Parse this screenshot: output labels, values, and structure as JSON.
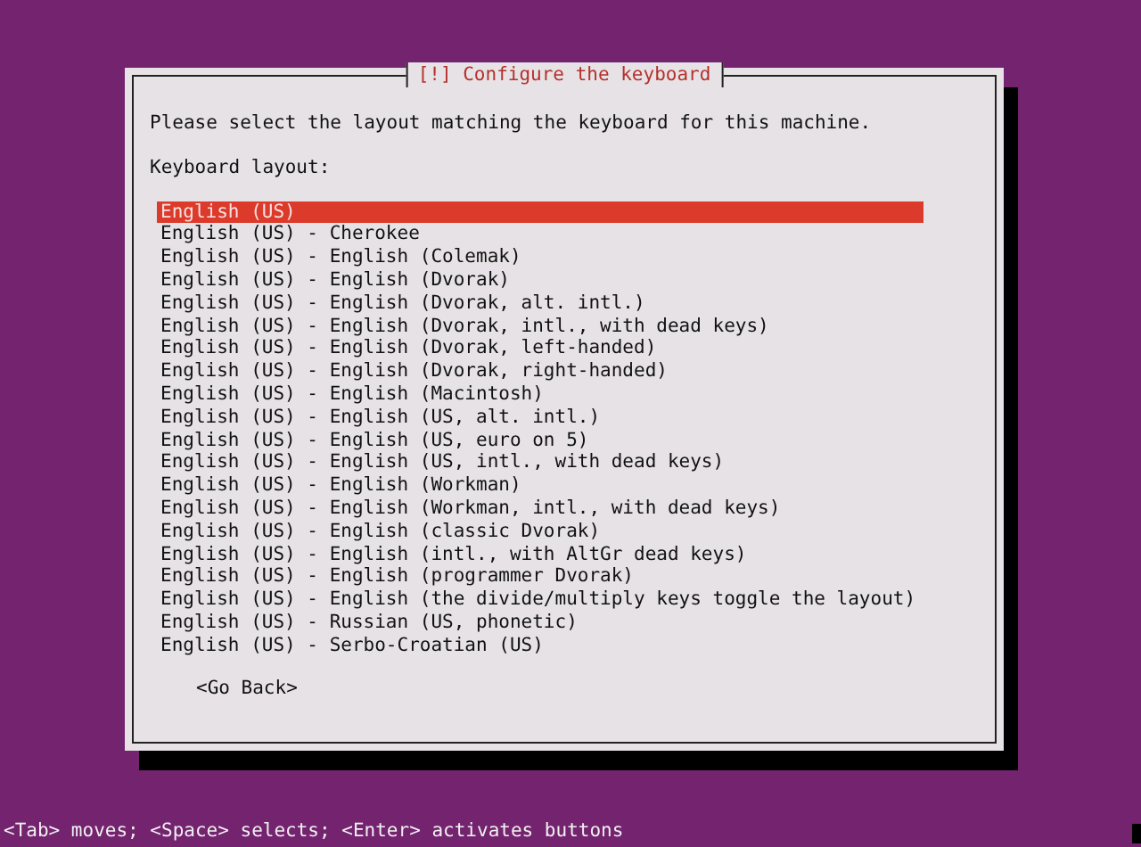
{
  "dialog": {
    "title": "[!] Configure the keyboard",
    "prompt": "Please select the layout matching the keyboard for this machine.",
    "list_label": "Keyboard layout:",
    "layouts": [
      {
        "label": "English (US)",
        "selected": true
      },
      {
        "label": "English (US) - Cherokee",
        "selected": false
      },
      {
        "label": "English (US) - English (Colemak)",
        "selected": false
      },
      {
        "label": "English (US) - English (Dvorak)",
        "selected": false
      },
      {
        "label": "English (US) - English (Dvorak, alt. intl.)",
        "selected": false
      },
      {
        "label": "English (US) - English (Dvorak, intl., with dead keys)",
        "selected": false
      },
      {
        "label": "English (US) - English (Dvorak, left-handed)",
        "selected": false
      },
      {
        "label": "English (US) - English (Dvorak, right-handed)",
        "selected": false
      },
      {
        "label": "English (US) - English (Macintosh)",
        "selected": false
      },
      {
        "label": "English (US) - English (US, alt. intl.)",
        "selected": false
      },
      {
        "label": "English (US) - English (US, euro on 5)",
        "selected": false
      },
      {
        "label": "English (US) - English (US, intl., with dead keys)",
        "selected": false
      },
      {
        "label": "English (US) - English (Workman)",
        "selected": false
      },
      {
        "label": "English (US) - English (Workman, intl., with dead keys)",
        "selected": false
      },
      {
        "label": "English (US) - English (classic Dvorak)",
        "selected": false
      },
      {
        "label": "English (US) - English (intl., with AltGr dead keys)",
        "selected": false
      },
      {
        "label": "English (US) - English (programmer Dvorak)",
        "selected": false
      },
      {
        "label": "English (US) - English (the divide/multiply keys toggle the layout)",
        "selected": false
      },
      {
        "label": "English (US) - Russian (US, phonetic)",
        "selected": false
      },
      {
        "label": "English (US) - Serbo-Croatian (US)",
        "selected": false
      }
    ],
    "back_button": "<Go Back>"
  },
  "status_bar": "<Tab> moves; <Space> selects; <Enter> activates buttons"
}
